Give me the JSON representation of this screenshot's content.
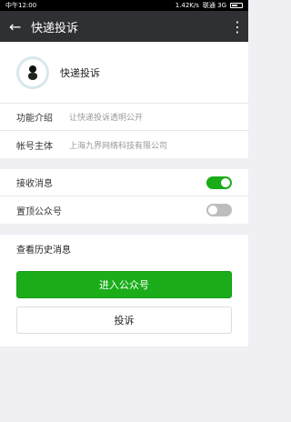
{
  "status": {
    "time": "中午12:00",
    "network_speed": "1.42K/s",
    "carrier": "联通 3G"
  },
  "appbar": {
    "title": "快递投诉",
    "back_icon": "arrow-left-icon",
    "more_icon": "more-vertical-icon"
  },
  "profile": {
    "name": "快递投诉"
  },
  "info": {
    "function_label": "功能介绍",
    "function_value": "让快递投诉透明公开",
    "owner_label": "帐号主体",
    "owner_value": "上海九界网络科技有限公司"
  },
  "settings": {
    "receive_label": "接收消息",
    "receive_on": true,
    "pin_label": "置顶公众号",
    "pin_on": false
  },
  "history": {
    "label": "查看历史消息"
  },
  "actions": {
    "enter_label": "进入公众号",
    "complain_label": "投诉"
  },
  "colors": {
    "accent": "#1aad19",
    "appbar": "#2f3033",
    "background": "#efeff4"
  }
}
